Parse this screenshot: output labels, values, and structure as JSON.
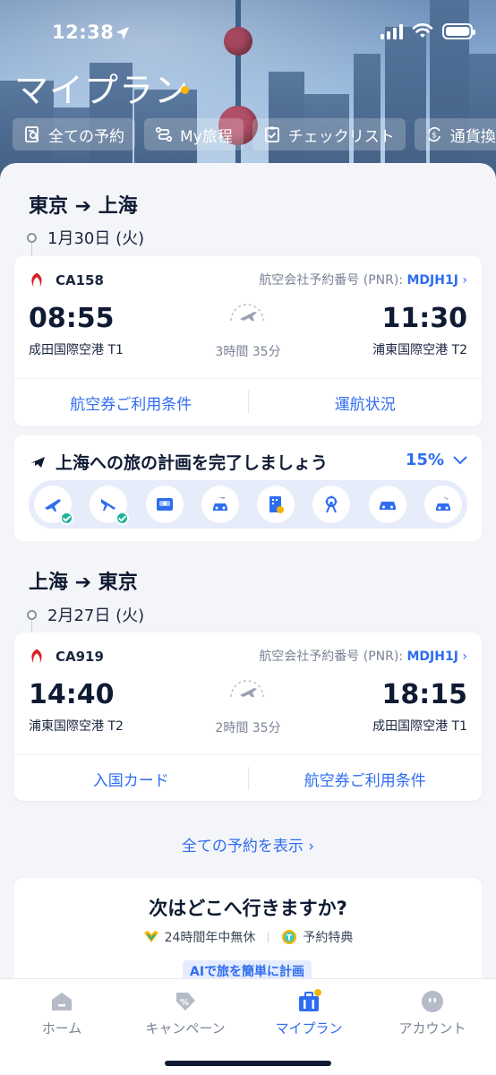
{
  "status_bar": {
    "time": "12:38"
  },
  "header": {
    "title": "マイプラン",
    "chips": [
      {
        "label": "全ての予約",
        "icon": "reservations-icon"
      },
      {
        "label": "My旅程",
        "icon": "itinerary-icon"
      },
      {
        "label": "チェックリスト",
        "icon": "checklist-icon"
      },
      {
        "label": "通貨換算",
        "icon": "currency-exchange-icon"
      }
    ]
  },
  "trips": [
    {
      "route": "東京 ➔ 上海",
      "date": "1月30日 (火)",
      "flight_no": "CA158",
      "pnr_label": "航空会社予約番号 (PNR):",
      "pnr": "MDJH1J",
      "dep_time": "08:55",
      "arr_time": "11:30",
      "dep_airport": "成田国際空港 T1",
      "arr_airport": "浦東国際空港 T2",
      "duration": "3時間 35分",
      "actions": [
        "航空券ご利用条件",
        "運航状況"
      ]
    },
    {
      "route": "上海 ➔ 東京",
      "date": "2月27日 (火)",
      "flight_no": "CA919",
      "pnr_label": "航空会社予約番号 (PNR):",
      "pnr": "MDJH1J",
      "dep_time": "14:40",
      "arr_time": "18:15",
      "dep_airport": "浦東国際空港 T2",
      "arr_airport": "成田国際空港 T1",
      "duration": "2時間 35分",
      "actions": [
        "入国カード",
        "航空券ご利用条件"
      ]
    }
  ],
  "plan": {
    "title": "上海への旅の計画を完了しましょう",
    "progress_percent": 15,
    "progress_label": "15%",
    "steps": [
      {
        "icon": "outbound-flight-icon",
        "done": true
      },
      {
        "icon": "return-flight-icon",
        "done": true
      },
      {
        "icon": "train-ticket-icon",
        "done": false
      },
      {
        "icon": "airport-transfer-icon",
        "done": false
      },
      {
        "icon": "hotel-icon",
        "done": false
      },
      {
        "icon": "attractions-icon",
        "done": false
      },
      {
        "icon": "car-rental-icon",
        "done": false
      },
      {
        "icon": "airport-pickup-icon",
        "done": false
      }
    ]
  },
  "show_all": "全ての予約を表示",
  "next": {
    "title": "次はどこへ行きますか?",
    "features": [
      "24時間年中無休",
      "予約特典"
    ],
    "ai_badge": "AIで旅を簡単に計画"
  },
  "tabs": [
    {
      "label": "ホーム",
      "icon": "home-icon",
      "active": false
    },
    {
      "label": "キャンペーン",
      "icon": "campaign-icon",
      "active": false
    },
    {
      "label": "マイプラン",
      "icon": "my-plan-icon",
      "active": true
    },
    {
      "label": "アカウント",
      "icon": "account-icon",
      "active": false
    }
  ],
  "colors": {
    "accent": "#2e6df0",
    "progress_done": "#16b39a",
    "brand_dot": "#ffb400"
  }
}
